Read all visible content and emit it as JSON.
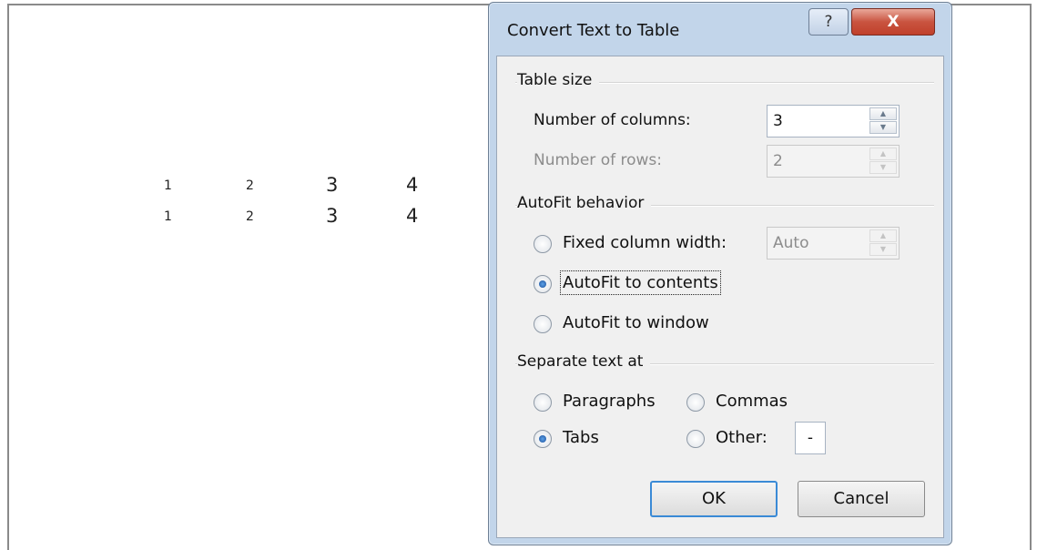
{
  "document": {
    "rows": [
      [
        "1",
        "2",
        "3",
        "4"
      ],
      [
        "1",
        "2",
        "3",
        "4"
      ]
    ]
  },
  "dialog": {
    "title": "Convert Text to Table",
    "help_glyph": "?",
    "close_glyph": "X",
    "table_size": {
      "group_label": "Table size",
      "columns_label": "Number of columns:",
      "columns_value": "3",
      "rows_label": "Number of rows:",
      "rows_value": "2"
    },
    "autofit": {
      "group_label": "AutoFit behavior",
      "fixed_label": "Fixed column width:",
      "fixed_value": "Auto",
      "contents_label": "AutoFit to contents",
      "window_label": "AutoFit to window",
      "selected": "contents"
    },
    "separate": {
      "group_label": "Separate text at",
      "paragraphs_label": "Paragraphs",
      "commas_label": "Commas",
      "tabs_label": "Tabs",
      "other_label": "Other:",
      "other_value": "-",
      "selected": "tabs"
    },
    "ok_label": "OK",
    "cancel_label": "Cancel"
  },
  "colors": {
    "dialog_frame": "#c2d5ea",
    "close_button": "#c95440",
    "default_button_border": "#3a8ad6"
  }
}
